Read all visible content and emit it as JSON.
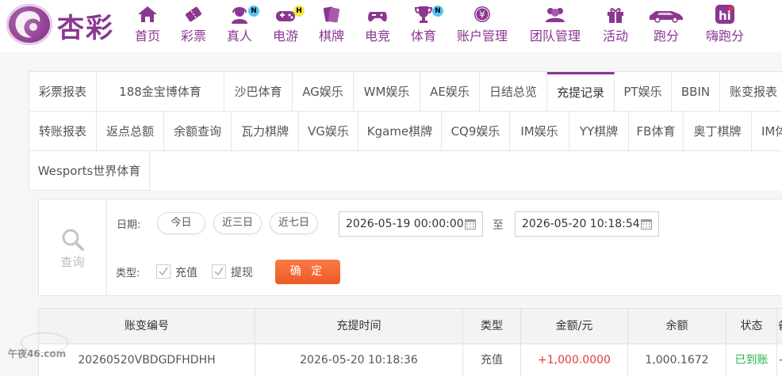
{
  "brand": {
    "name": "杏彩"
  },
  "nav": [
    {
      "label": "首页",
      "icon": "home-icon"
    },
    {
      "label": "彩票",
      "icon": "lottery-ticket-icon"
    },
    {
      "label": "真人",
      "icon": "live-dealer-icon",
      "badge": "N"
    },
    {
      "label": "电游",
      "icon": "gamepad-icon",
      "badge": "H"
    },
    {
      "label": "棋牌",
      "icon": "playing-cards-icon"
    },
    {
      "label": "电竞",
      "icon": "esports-controller-icon"
    },
    {
      "label": "体育",
      "icon": "trophy-icon",
      "badge": "N"
    },
    {
      "label": "账户管理",
      "icon": "yen-coin-icon"
    },
    {
      "label": "团队管理",
      "icon": "team-icon"
    },
    {
      "label": "活动",
      "icon": "gift-icon"
    },
    {
      "label": "跑分",
      "icon": "car-icon"
    },
    {
      "label": "嗨跑分",
      "icon": "hi-app-icon"
    }
  ],
  "tabs": [
    "彩票报表",
    "188金宝博体育",
    "沙巴体育",
    "AG娱乐",
    "WM娱乐",
    "AE娱乐",
    "日结总览",
    "充提记录",
    "PT娱乐",
    "BBIN",
    "账变报表",
    "转账报表",
    "返点总额",
    "余额查询",
    "瓦力棋牌",
    "VG娱乐",
    "Kgame棋牌",
    "CQ9娱乐",
    "IM娱乐",
    "YY棋牌",
    "FB体育",
    "奥丁棋牌",
    "IM体育",
    "Wesports世界体育"
  ],
  "active_tab": "充提记录",
  "filter": {
    "search_label": "查询",
    "date_label": "日期:",
    "quick_ranges": [
      "今日",
      "近三日",
      "近七日"
    ],
    "start": "2026-05-19 00:00:00",
    "to_label": "至",
    "end": "2026-05-20 10:18:54",
    "type_label": "类型:",
    "types": [
      {
        "label": "充值",
        "checked": true
      },
      {
        "label": "提现",
        "checked": true
      }
    ],
    "confirm_label": "确 定"
  },
  "table": {
    "headers": [
      "账变编号",
      "充提时间",
      "类型",
      "金额/元",
      "余额",
      "状态",
      "备注"
    ],
    "rows": [
      [
        "20260520VBDGDFHDHH",
        "2026-05-20 10:18:36",
        "充值",
        "+1,000.0000",
        "1,000.1672",
        "已到账",
        "-"
      ]
    ]
  },
  "watermark": {
    "text": "午夜46.com"
  },
  "colors": {
    "brand": "#8a3790",
    "confirm": "#ec5a25",
    "positive_amount": "#e23a3a",
    "status_ok": "#2bb24a"
  }
}
